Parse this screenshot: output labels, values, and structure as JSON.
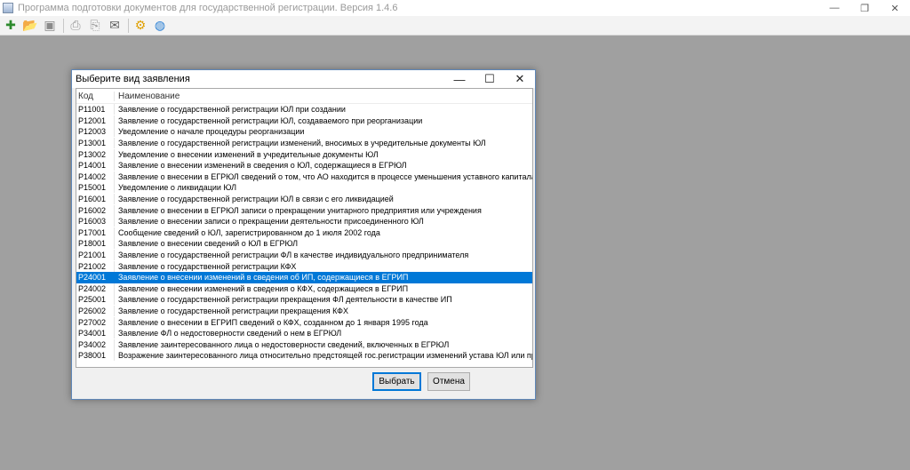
{
  "app": {
    "title": "Программа подготовки документов для государственной регистрации. Версия 1.4.6",
    "controls": {
      "minimize": "—",
      "restore": "❐",
      "close": "✕"
    }
  },
  "toolbar": {
    "buttons": [
      {
        "name": "new-document-icon",
        "glyph": "✚",
        "color": "#2e8b2e"
      },
      {
        "name": "open-folder-icon",
        "glyph": "📂",
        "color": "#d9a520"
      },
      {
        "name": "save-icon",
        "glyph": "▣",
        "color": "#8a8a8a"
      },
      {
        "name": "print-icon",
        "glyph": "⎙",
        "color": "#9a9a9a"
      },
      {
        "name": "print-preview-icon",
        "glyph": "⎘",
        "color": "#9a9a9a"
      },
      {
        "name": "mail-icon",
        "glyph": "✉",
        "color": "#606060"
      },
      {
        "name": "settings-gear-icon",
        "glyph": "⚙",
        "color": "#e0a000"
      },
      {
        "name": "help-globe-icon",
        "glyph": "◍",
        "color": "#2a7fd4"
      }
    ]
  },
  "dialog": {
    "title": "Выберите вид заявления",
    "controls": {
      "minimize": "—",
      "maximize": "☐",
      "close": "✕"
    },
    "columns": {
      "code": "Код",
      "name": "Наименование"
    },
    "selected_code": "Р24001",
    "rows": [
      {
        "code": "Р11001",
        "name": "Заявление о государственной регистрации ЮЛ при создании"
      },
      {
        "code": "Р12001",
        "name": "Заявление о государственной регистрации ЮЛ, создаваемого при реорганизации"
      },
      {
        "code": "Р12003",
        "name": "Уведомление о начале процедуры реорганизации"
      },
      {
        "code": "Р13001",
        "name": "Заявление о государственной регистрации изменений, вносимых в учредительные документы ЮЛ"
      },
      {
        "code": "Р13002",
        "name": "Уведомление о внесении изменений в учредительные документы ЮЛ"
      },
      {
        "code": "Р14001",
        "name": "Заявление о внесении изменений в сведения о ЮЛ, содержащиеся в ЕГРЮЛ"
      },
      {
        "code": "Р14002",
        "name": "Заявление о внесении в ЕГРЮЛ сведений о том, что АО находится в процессе уменьшения уставного капитала, а так..."
      },
      {
        "code": "Р15001",
        "name": "Уведомление о ликвидации ЮЛ"
      },
      {
        "code": "Р16001",
        "name": "Заявление о государственной регистрации ЮЛ в связи с его ликвидацией"
      },
      {
        "code": "Р16002",
        "name": "Заявление о внесении в ЕГРЮЛ записи о прекращении унитарного предприятия или учреждения"
      },
      {
        "code": "Р16003",
        "name": "Заявление о внесении записи о прекращении деятельности присоединенного ЮЛ"
      },
      {
        "code": "Р17001",
        "name": "Сообщение сведений о ЮЛ, зарегистрированном до 1 июля 2002 года"
      },
      {
        "code": "Р18001",
        "name": "Заявление о внесении сведений о ЮЛ в ЕГРЮЛ"
      },
      {
        "code": "Р21001",
        "name": "Заявление о государственной регистрации ФЛ в качестве индивидуального предпринимателя"
      },
      {
        "code": "Р21002",
        "name": "Заявление о государственной регистрации КФХ"
      },
      {
        "code": "Р24001",
        "name": "Заявление о внесении изменений в сведения об ИП, содержащиеся в ЕГРИП"
      },
      {
        "code": "Р24002",
        "name": "Заявление о внесении изменений в сведения о КФХ, содержащиеся в ЕГРИП"
      },
      {
        "code": "Р25001",
        "name": "Заявление о государственной регистрации прекращения ФЛ деятельности в качестве ИП"
      },
      {
        "code": "Р26002",
        "name": "Заявление о государственной регистрации прекращения КФХ"
      },
      {
        "code": "Р27002",
        "name": "Заявление о внесении в ЕГРИП сведений о КФХ, созданном до 1 января 1995 года"
      },
      {
        "code": "Р34001",
        "name": "Заявление ФЛ о недостоверности сведений о нем в ЕГРЮЛ"
      },
      {
        "code": "Р34002",
        "name": "Заявление заинтересованного лица о недостоверности сведений, включенных в ЕГРЮЛ"
      },
      {
        "code": "Р38001",
        "name": "Возражение заинтересованного лица относительно предстоящей гос.регистрации изменений устава ЮЛ или предсто..."
      }
    ],
    "buttons": {
      "select": "Выбрать",
      "cancel": "Отмена"
    }
  }
}
